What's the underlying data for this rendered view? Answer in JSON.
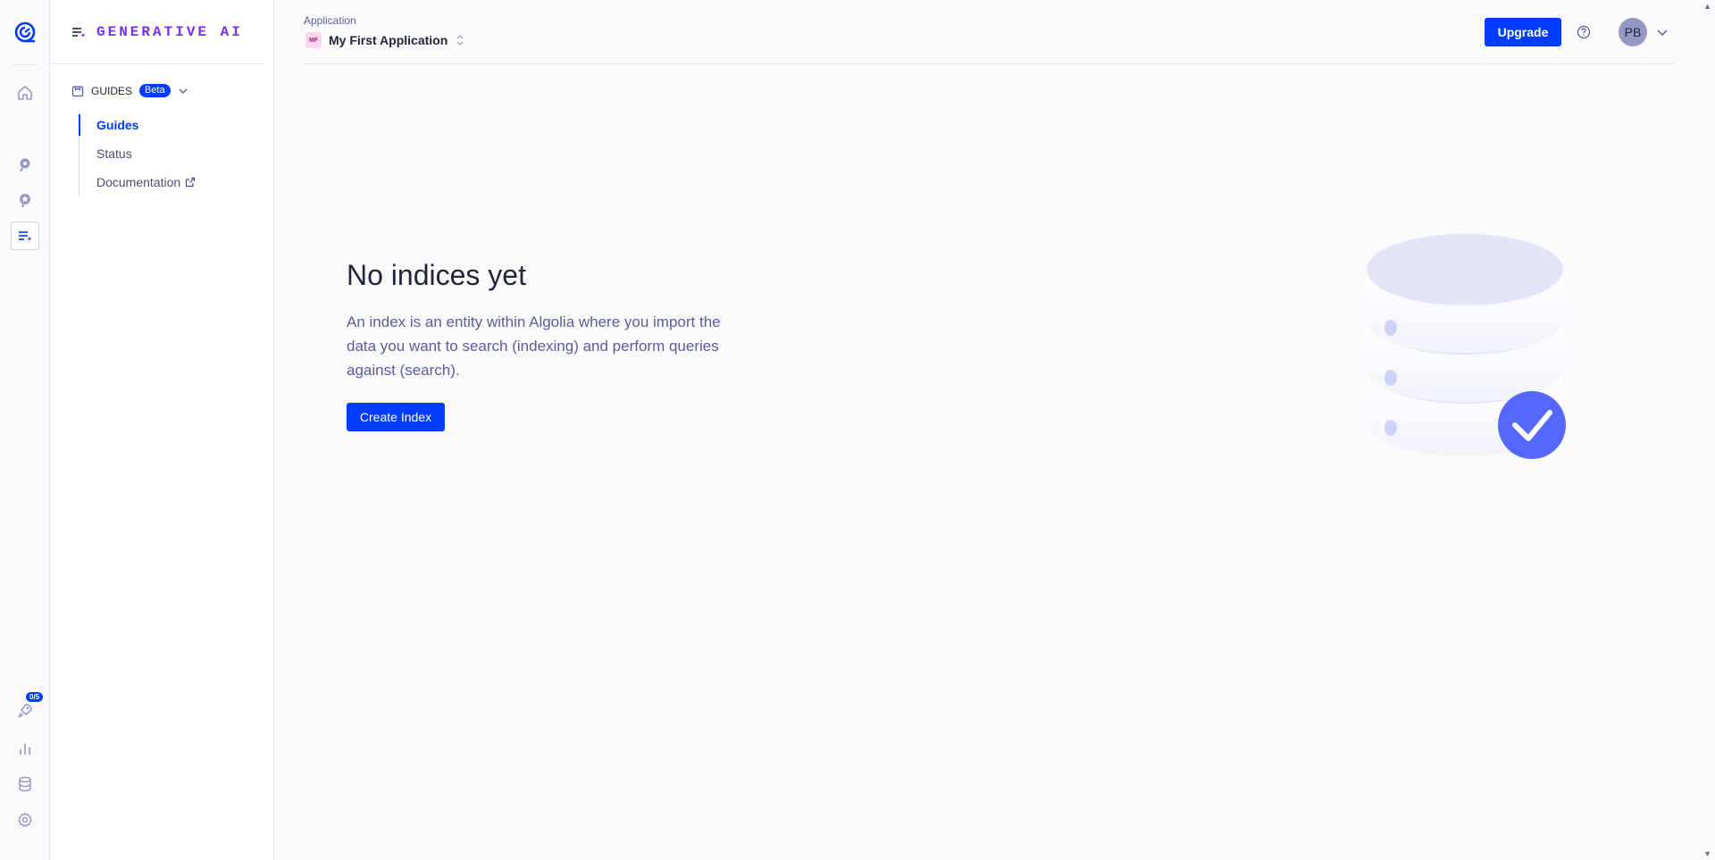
{
  "rail": {
    "badge": "0/5"
  },
  "sidebar": {
    "brand": "GENERATIVE AI",
    "section_label": "GUIDES",
    "section_badge": "Beta",
    "items": [
      {
        "label": "Guides"
      },
      {
        "label": "Status"
      },
      {
        "label": "Documentation"
      }
    ]
  },
  "header": {
    "app_label": "Application",
    "app_initials": "MF",
    "app_name": "My First Application",
    "upgrade_label": "Upgrade",
    "user_initials": "PB"
  },
  "main": {
    "title": "No indices yet",
    "description": "An index is an entity within Algolia where you import the data you want to search (indexing) and perform queries against (search).",
    "create_label": "Create Index"
  },
  "colors": {
    "primary": "#003dff",
    "brand": "#7a2ff5",
    "illustration": "#5468ff"
  }
}
